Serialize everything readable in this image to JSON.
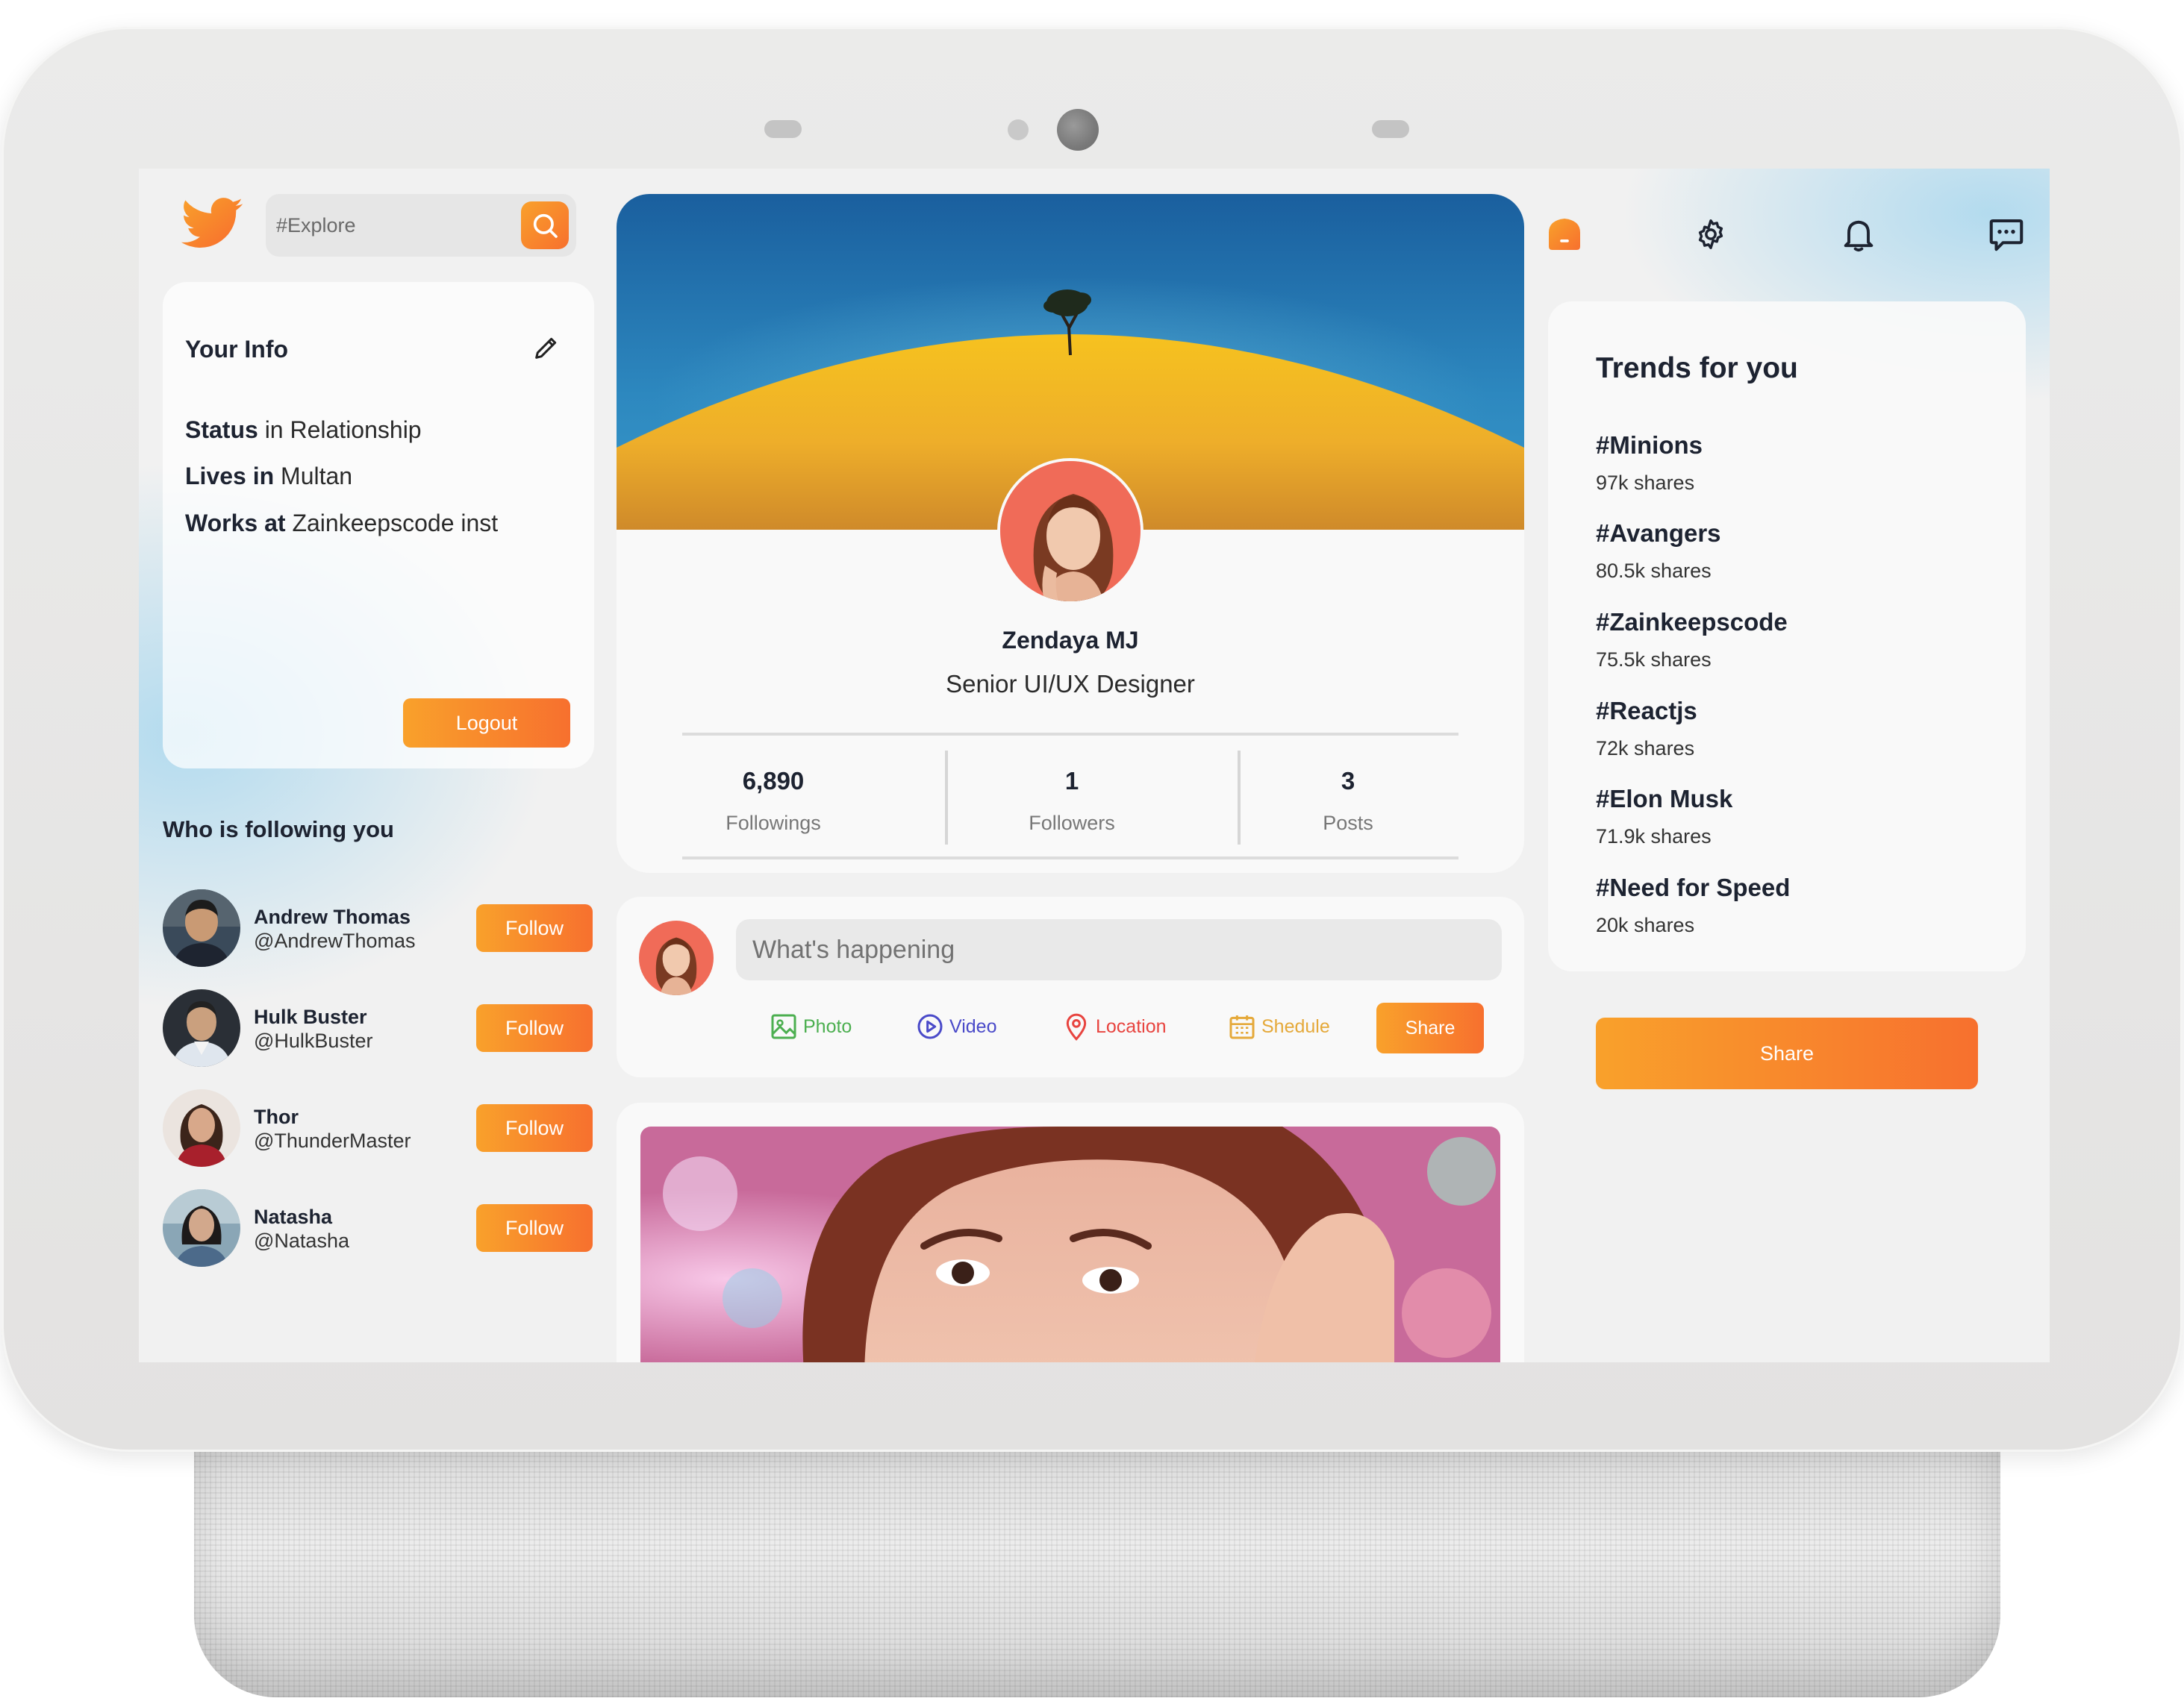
{
  "search": {
    "placeholder": "#Explore"
  },
  "your_info": {
    "title": "Your Info",
    "status_label": "Status",
    "status_value": "in Relationship",
    "lives_label": "Lives in",
    "lives_value": "Multan",
    "works_label": "Works at",
    "works_value": "Zainkeepscode inst",
    "logout_label": "Logout"
  },
  "followers_section": {
    "title": "Who is following you",
    "items": [
      {
        "name": "Andrew Thomas",
        "handle": "@AndrewThomas",
        "button": "Follow"
      },
      {
        "name": "Hulk Buster",
        "handle": "@HulkBuster",
        "button": "Follow"
      },
      {
        "name": "Thor",
        "handle": "@ThunderMaster",
        "button": "Follow"
      },
      {
        "name": "Natasha",
        "handle": "@Natasha",
        "button": "Follow"
      }
    ]
  },
  "profile": {
    "name": "Zendaya MJ",
    "role": "Senior UI/UX Designer",
    "stats": [
      {
        "value": "6,890",
        "label": "Followings"
      },
      {
        "value": "1",
        "label": "Followers"
      },
      {
        "value": "3",
        "label": "Posts"
      }
    ]
  },
  "post_box": {
    "placeholder": "What's happening",
    "options": [
      {
        "label": "Photo",
        "color": "#4caf50",
        "icon": "image-icon"
      },
      {
        "label": "Video",
        "color": "#4a4ac9",
        "icon": "play-circle-icon"
      },
      {
        "label": "Location",
        "color": "#e8443f",
        "icon": "map-pin-icon"
      },
      {
        "label": "Shedule",
        "color": "#e5a93a",
        "icon": "calendar-icon"
      }
    ],
    "share_label": "Share"
  },
  "top_nav": {
    "icons": [
      "home-icon",
      "gear-icon",
      "bell-icon",
      "chat-icon"
    ]
  },
  "trends": {
    "title": "Trends for you",
    "items": [
      {
        "tag": "#Minions",
        "shares": "97k shares"
      },
      {
        "tag": "#Avangers",
        "shares": "80.5k shares"
      },
      {
        "tag": "#Zainkeepscode",
        "shares": "75.5k shares"
      },
      {
        "tag": "#Reactjs",
        "shares": "72k shares"
      },
      {
        "tag": "#Elon Musk",
        "shares": "71.9k shares"
      },
      {
        "tag": "#Need for Speed",
        "shares": "20k shares"
      }
    ],
    "share_label": "Share"
  },
  "colors": {
    "accent_start": "#f9a12b",
    "accent_end": "#f7702e",
    "text_dark": "#1d2331",
    "sky_blue": "#a8d7ee"
  }
}
